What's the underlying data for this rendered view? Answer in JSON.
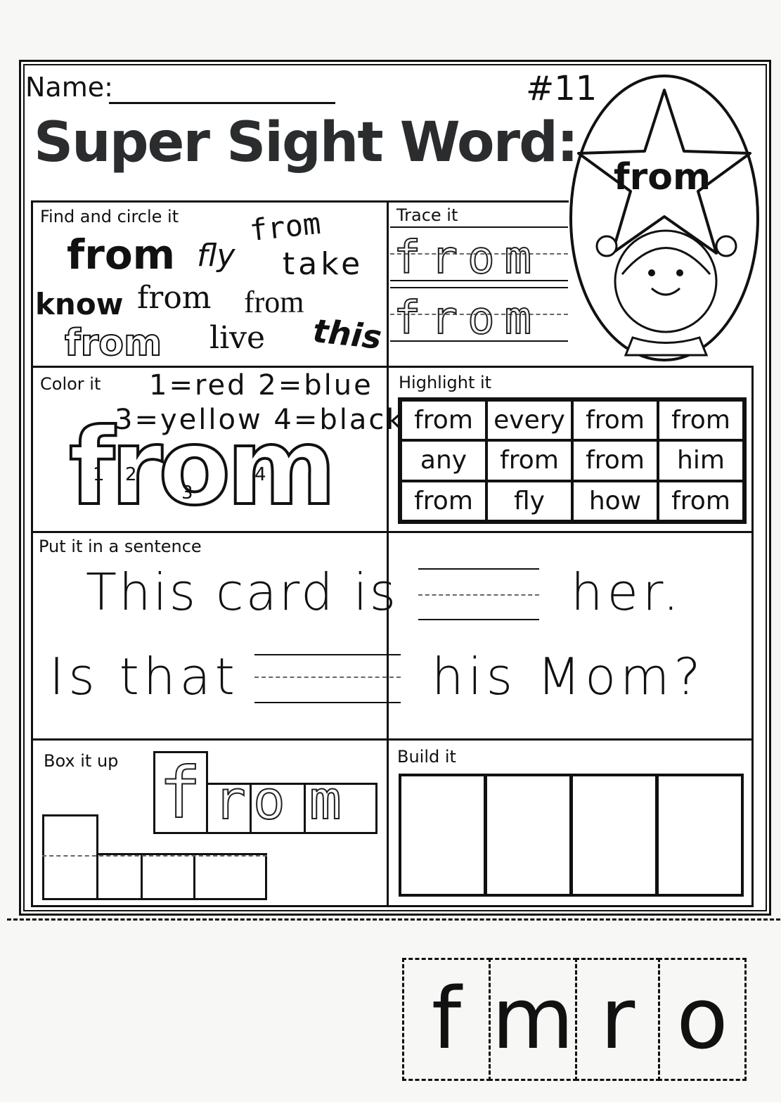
{
  "header": {
    "name_label": "Name:",
    "number": "#11",
    "title": "Super Sight Word:",
    "star_word": "from"
  },
  "find": {
    "label": "Find and circle it",
    "words": [
      "from",
      "from",
      "fly",
      "take",
      "know",
      "from",
      "from",
      "from",
      "live",
      "this"
    ]
  },
  "trace": {
    "label": "Trace it",
    "rows": [
      "from",
      "from"
    ]
  },
  "color": {
    "label": "Color it",
    "key_line1": "1=red 2=blue",
    "key_line2": "3=yellow 4=black",
    "word": "from",
    "numbers": [
      "1",
      "2",
      "3",
      "4"
    ]
  },
  "highlight": {
    "label": "Highlight it",
    "cells": [
      "from",
      "every",
      "from",
      "from",
      "any",
      "from",
      "from",
      "him",
      "from",
      "fly",
      "how",
      "from"
    ]
  },
  "sentence": {
    "label": "Put it in a sentence",
    "line1_a": "This card is",
    "line1_b": "her.",
    "line2_a": "Is that",
    "line2_b": "his Mom?"
  },
  "boxit": {
    "label": "Box it up",
    "letters": [
      "f",
      "r",
      "o",
      "m"
    ]
  },
  "build": {
    "label": "Build it"
  },
  "cutout": {
    "letters": [
      "f",
      "m",
      "r",
      "o"
    ]
  }
}
